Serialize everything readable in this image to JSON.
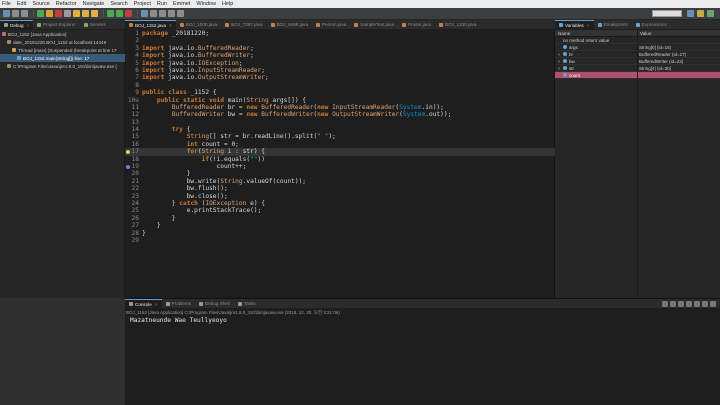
{
  "menu": [
    "File",
    "Edit",
    "Source",
    "Refactor",
    "Navigate",
    "Search",
    "Project",
    "Run",
    "Emmet",
    "Window",
    "Help"
  ],
  "debug_view": {
    "tabs": [
      {
        "label": "Debug",
        "active": true
      },
      {
        "label": "Project Explorer",
        "active": false
      },
      {
        "label": "Servers",
        "active": false
      }
    ],
    "tree": [
      {
        "text": "BOJ_1152 [Java Application]",
        "indent": 0,
        "icon": "java-app-icon",
        "color": "#c36b6b"
      },
      {
        "text": "date_20181220.BOJ_1152 at localhost:14449",
        "indent": 1,
        "icon": "java-vm-icon",
        "color": "#a58c5c"
      },
      {
        "text": "Thread [main] (Suspended (breakpoint at line 17",
        "indent": 2,
        "icon": "thread-icon",
        "color": "#d4a24a"
      },
      {
        "text": "BOJ_1152.main(String[]) line: 17",
        "indent": 3,
        "icon": "stack-frame-icon",
        "color": "#6a9fd4",
        "selected": true
      },
      {
        "text": "C:\\Program Files\\Java\\jre1.8.0_191\\bin\\javaw.exe (",
        "indent": 1,
        "icon": "process-icon",
        "color": "#7a9a6a"
      }
    ]
  },
  "editor": {
    "tabs": [
      {
        "label": "BOJ_1152.java",
        "active": true
      },
      {
        "label": "BOJ_1000.java",
        "active": false
      },
      {
        "label": "BOJ_7287.java",
        "active": false
      },
      {
        "label": "BOJ_8498.java",
        "active": false
      },
      {
        "label": "Person.java",
        "active": false
      },
      {
        "label": "SampleTest.java",
        "active": false
      },
      {
        "label": "Printer.java",
        "active": false
      },
      {
        "label": "BOJ_1330.java",
        "active": false
      }
    ],
    "lines": [
      {
        "n": "1",
        "code": "package date_20181220;"
      },
      {
        "n": "2",
        "code": ""
      },
      {
        "n": "3",
        "code": "import java.io.BufferedReader;"
      },
      {
        "n": "4",
        "code": "import java.io.BufferedWriter;"
      },
      {
        "n": "5",
        "code": "import java.io.IOException;"
      },
      {
        "n": "6",
        "code": "import java.io.InputStreamReader;"
      },
      {
        "n": "7",
        "code": "import java.io.OutputStreamWriter;"
      },
      {
        "n": "8",
        "code": ""
      },
      {
        "n": "9",
        "code": "public class BOJ_1152 {"
      },
      {
        "n": "10⊖",
        "code": "    public static void main(String args[]) {"
      },
      {
        "n": "11",
        "code": "        BufferedReader br = new BufferedReader(new InputStreamReader(System.in));"
      },
      {
        "n": "12",
        "code": "        BufferedWriter bw = new BufferedWriter(new OutputStreamWriter(System.out));"
      },
      {
        "n": "13",
        "code": ""
      },
      {
        "n": "14",
        "code": "        try {"
      },
      {
        "n": "15",
        "code": "            String[] str = br.readLine().split(\" \");"
      },
      {
        "n": "16",
        "code": "            int count = 0;"
      },
      {
        "n": "17",
        "code": "            for(String i : str) {",
        "current": true,
        "breakpoint": "current"
      },
      {
        "n": "18",
        "code": "                if(!i.equals(\"\"))"
      },
      {
        "n": "19",
        "code": "                    count++;",
        "breakpoint": "normal"
      },
      {
        "n": "20",
        "code": "            }"
      },
      {
        "n": "21",
        "code": "            bw.write(String.valueOf(count));"
      },
      {
        "n": "22",
        "code": "            bw.flush();"
      },
      {
        "n": "23",
        "code": "            bw.close();"
      },
      {
        "n": "24",
        "code": "        } catch (IOException e) {"
      },
      {
        "n": "25",
        "code": "            e.printStackTrace();"
      },
      {
        "n": "26",
        "code": "        }"
      },
      {
        "n": "27",
        "code": "    }"
      },
      {
        "n": "28",
        "code": "}"
      },
      {
        "n": "29",
        "code": ""
      }
    ]
  },
  "variables_view": {
    "tabs": [
      {
        "label": "Variables",
        "active": true
      },
      {
        "label": "Breakpoints",
        "active": false
      },
      {
        "label": "Expressions",
        "active": false
      }
    ],
    "columns": {
      "name": "Name",
      "value": "Value"
    },
    "rows": [
      {
        "name": "no method return value",
        "value": "",
        "expand": "",
        "icon": false
      },
      {
        "name": "args",
        "value": "String[0]  (id=16)",
        "expand": "",
        "icon": true
      },
      {
        "name": "br",
        "value": "BufferedReader  (id=17)",
        "expand": ">",
        "icon": true
      },
      {
        "name": "bw",
        "value": "BufferedWriter  (id=23)",
        "expand": ">",
        "icon": true
      },
      {
        "name": "str",
        "value": "String[4]  (id=30)",
        "expand": ">",
        "icon": true
      },
      {
        "name": "count",
        "value": "",
        "expand": "",
        "icon": true,
        "changed": true
      }
    ]
  },
  "console_view": {
    "tabs": [
      {
        "label": "Console",
        "active": true
      },
      {
        "label": "Problems",
        "active": false
      },
      {
        "label": "Debug Shell",
        "active": false
      },
      {
        "label": "Tasks",
        "active": false
      }
    ],
    "info": "BOJ_1152 [Java Application] C:\\Program Files\\Java\\jre1.8.0_191\\bin\\javaw.exe (2018. 12. 20. 오전 3:21:06)",
    "output": "Mazatneunde Wae Teullyeoyo"
  },
  "colors": {
    "accent": "#6a9fd4",
    "keyword": "#cc7832",
    "string": "#17c6a3",
    "changed_row": "#b1506a"
  }
}
